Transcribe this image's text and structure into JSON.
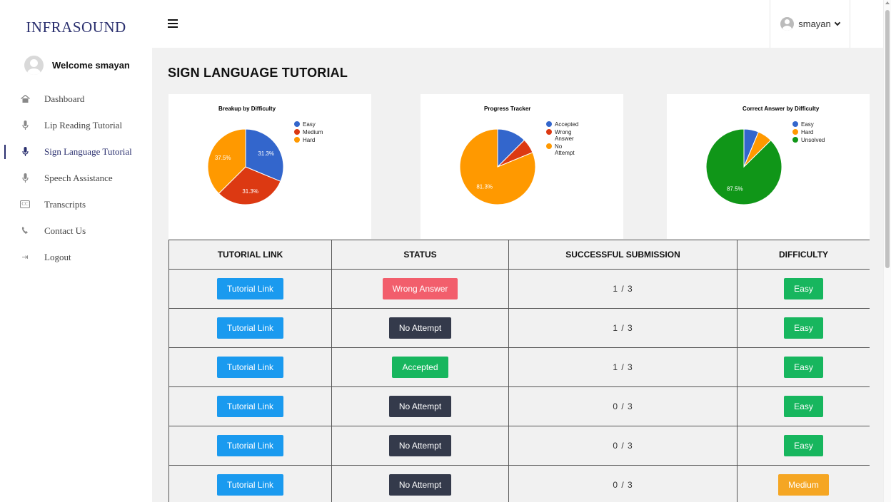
{
  "brand": "INFRASOUND",
  "welcome": "Welcome smayan",
  "nav": [
    {
      "label": "Dashboard",
      "icon": "home-icon",
      "active": false
    },
    {
      "label": "Lip Reading Tutorial",
      "icon": "microphone-icon",
      "active": false
    },
    {
      "label": "Sign Language Tutorial",
      "icon": "microphone-icon",
      "active": true
    },
    {
      "label": "Speech Assistance",
      "icon": "microphone-icon",
      "active": false
    },
    {
      "label": "Transcripts",
      "icon": "cc-icon",
      "active": false
    },
    {
      "label": "Contact Us",
      "icon": "phone-icon",
      "active": false
    },
    {
      "label": "Logout",
      "icon": "logout-icon",
      "active": false
    }
  ],
  "user": {
    "name": "smayan"
  },
  "page_title": "SIGN LANGUAGE TUTORIAL",
  "colors": {
    "blue": "#3366cc",
    "red": "#dc3912",
    "orange": "#ff9900",
    "green": "#109618"
  },
  "chart_data": [
    {
      "type": "pie",
      "title": "Breakup by Difficulty",
      "slices": [
        {
          "label": "Easy",
          "value": 31.3,
          "color": "#3366cc",
          "show_label": true
        },
        {
          "label": "Medium",
          "value": 31.3,
          "color": "#dc3912",
          "show_label": true
        },
        {
          "label": "Hard",
          "value": 37.5,
          "color": "#ff9900",
          "show_label": true
        }
      ],
      "legend": "right"
    },
    {
      "type": "pie",
      "title": "Progress Tracker",
      "slices": [
        {
          "label": "Accepted",
          "value": 12.5,
          "color": "#3366cc",
          "show_label": false
        },
        {
          "label": "Wrong Answer",
          "value": 6.3,
          "color": "#dc3912",
          "show_label": false
        },
        {
          "label": "No Attempt",
          "value": 81.3,
          "color": "#ff9900",
          "show_label": true
        }
      ],
      "legend": "right"
    },
    {
      "type": "pie",
      "title": "Correct Answer by Difficulty",
      "slices": [
        {
          "label": "Easy",
          "value": 6.3,
          "color": "#3366cc",
          "show_label": false
        },
        {
          "label": "Hard",
          "value": 6.3,
          "color": "#ff9900",
          "show_label": false
        },
        {
          "label": "Unsolved",
          "value": 87.5,
          "color": "#109618",
          "show_label": true
        }
      ],
      "legend": "right"
    }
  ],
  "table": {
    "headers": [
      "TUTORIAL LINK",
      "STATUS",
      "SUCCESSFUL SUBMISSION",
      "DIFFICULTY"
    ],
    "rows": [
      {
        "link": "Tutorial Link",
        "status": "Wrong Answer",
        "status_kind": "wrong",
        "submission": "1 / 3",
        "difficulty": "Easy"
      },
      {
        "link": "Tutorial Link",
        "status": "No Attempt",
        "status_kind": "none",
        "submission": "1 / 3",
        "difficulty": "Easy"
      },
      {
        "link": "Tutorial Link",
        "status": "Accepted",
        "status_kind": "acc",
        "submission": "1 / 3",
        "difficulty": "Easy"
      },
      {
        "link": "Tutorial Link",
        "status": "No Attempt",
        "status_kind": "none",
        "submission": "0 / 3",
        "difficulty": "Easy"
      },
      {
        "link": "Tutorial Link",
        "status": "No Attempt",
        "status_kind": "none",
        "submission": "0 / 3",
        "difficulty": "Easy"
      },
      {
        "link": "Tutorial Link",
        "status": "No Attempt",
        "status_kind": "none",
        "submission": "0 / 3",
        "difficulty": "Medium"
      }
    ]
  }
}
